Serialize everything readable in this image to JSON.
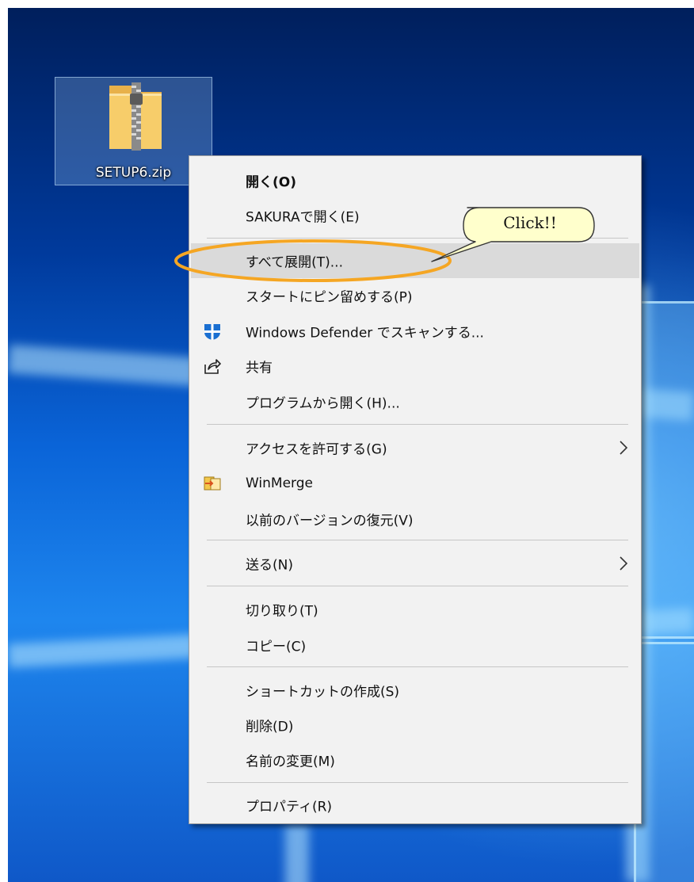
{
  "desktop": {
    "icon": {
      "name": "zip-folder-icon",
      "label": "SETUP6.zip"
    }
  },
  "context_menu": {
    "items": [
      {
        "label": "開く(O)",
        "bold": true
      },
      {
        "label": "SAKURAで開く(E)"
      },
      {
        "label": "すべて展開(T)...",
        "highlighted": true
      },
      {
        "label": "スタートにピン留めする(P)"
      },
      {
        "label": "Windows Defender でスキャンする...",
        "icon": "windows-defender-shield-icon"
      },
      {
        "label": "共有",
        "icon": "share-icon"
      },
      {
        "label": "プログラムから開く(H)..."
      },
      {
        "label": "アクセスを許可する(G)",
        "submenu": true
      },
      {
        "label": "WinMerge",
        "icon": "winmerge-icon"
      },
      {
        "label": "以前のバージョンの復元(V)"
      },
      {
        "label": "送る(N)",
        "submenu": true
      },
      {
        "label": "切り取り(T)"
      },
      {
        "label": "コピー(C)"
      },
      {
        "label": "ショートカットの作成(S)"
      },
      {
        "label": "削除(D)"
      },
      {
        "label": "名前の変更(M)"
      },
      {
        "label": "プロパティ(R)"
      }
    ]
  },
  "annotation": {
    "callout_text": "Click!!",
    "highlight_color": "#f5a623",
    "callout_fill": "#ffffcc"
  },
  "colors": {
    "menu_background": "#f2f2f2",
    "highlight_background": "#dadada",
    "wallpaper_blue": "#0a64d8"
  }
}
